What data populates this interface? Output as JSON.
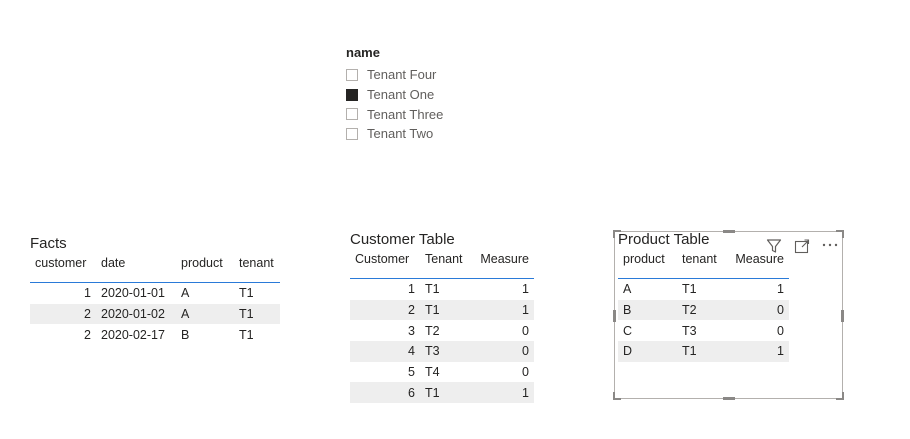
{
  "slicer": {
    "title": "name",
    "items": [
      {
        "label": "Tenant Four",
        "checked": false
      },
      {
        "label": "Tenant One",
        "checked": true
      },
      {
        "label": "Tenant Three",
        "checked": false
      },
      {
        "label": "Tenant Two",
        "checked": false
      }
    ]
  },
  "facts": {
    "title": "Facts",
    "columns": [
      "customer",
      "date",
      "product",
      "tenant"
    ],
    "rows": [
      [
        "1",
        "2020-01-01",
        "A",
        "T1"
      ],
      [
        "2",
        "2020-01-02",
        "A",
        "T1"
      ],
      [
        "2",
        "2020-02-17",
        "B",
        "T1"
      ]
    ]
  },
  "customer_table": {
    "title": "Customer Table",
    "columns": [
      "Customer",
      "Tenant",
      "Measure"
    ],
    "rows": [
      [
        "1",
        "T1",
        "1"
      ],
      [
        "2",
        "T1",
        "1"
      ],
      [
        "3",
        "T2",
        "0"
      ],
      [
        "4",
        "T3",
        "0"
      ],
      [
        "5",
        "T4",
        "0"
      ],
      [
        "6",
        "T1",
        "1"
      ]
    ]
  },
  "product_table": {
    "title": "Product Table",
    "columns": [
      "product",
      "tenant",
      "Measure"
    ],
    "rows": [
      [
        "A",
        "T1",
        "1"
      ],
      [
        "B",
        "T2",
        "0"
      ],
      [
        "C",
        "T3",
        "0"
      ],
      [
        "D",
        "T1",
        "1"
      ]
    ]
  },
  "toolbar": {
    "icons": [
      "filter-icon",
      "focus-mode-icon",
      "more-options-icon"
    ]
  }
}
